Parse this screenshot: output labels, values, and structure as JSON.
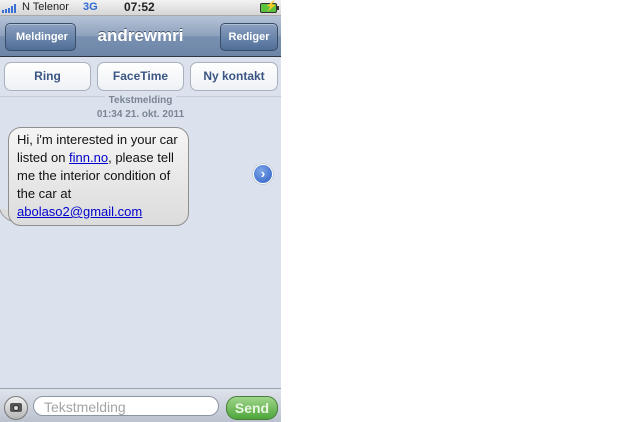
{
  "status_bar": {
    "carrier": "N Telenor",
    "network": "3G",
    "time": "07:52"
  },
  "nav": {
    "back_label": "Meldinger",
    "title": "andrewmri",
    "edit_label": "Rediger"
  },
  "actions": {
    "call": "Ring",
    "facetime": "FaceTime",
    "new_contact": "Ny kontakt"
  },
  "thread": {
    "type_label": "Tekstmelding",
    "timestamp": "01:34 21. okt. 2011"
  },
  "message": {
    "part1": "Hi, i'm interested in your car listed on ",
    "link1": "finn.no",
    "part2": ", please tell me the interior condition of the car at ",
    "link2": "abolaso2@gmail.com"
  },
  "composer": {
    "placeholder": "Tekstmelding",
    "send_label": "Send"
  },
  "colors": {
    "accent": "#2f6ad3",
    "send_green": "#4da63a",
    "link": "#0000cc"
  }
}
